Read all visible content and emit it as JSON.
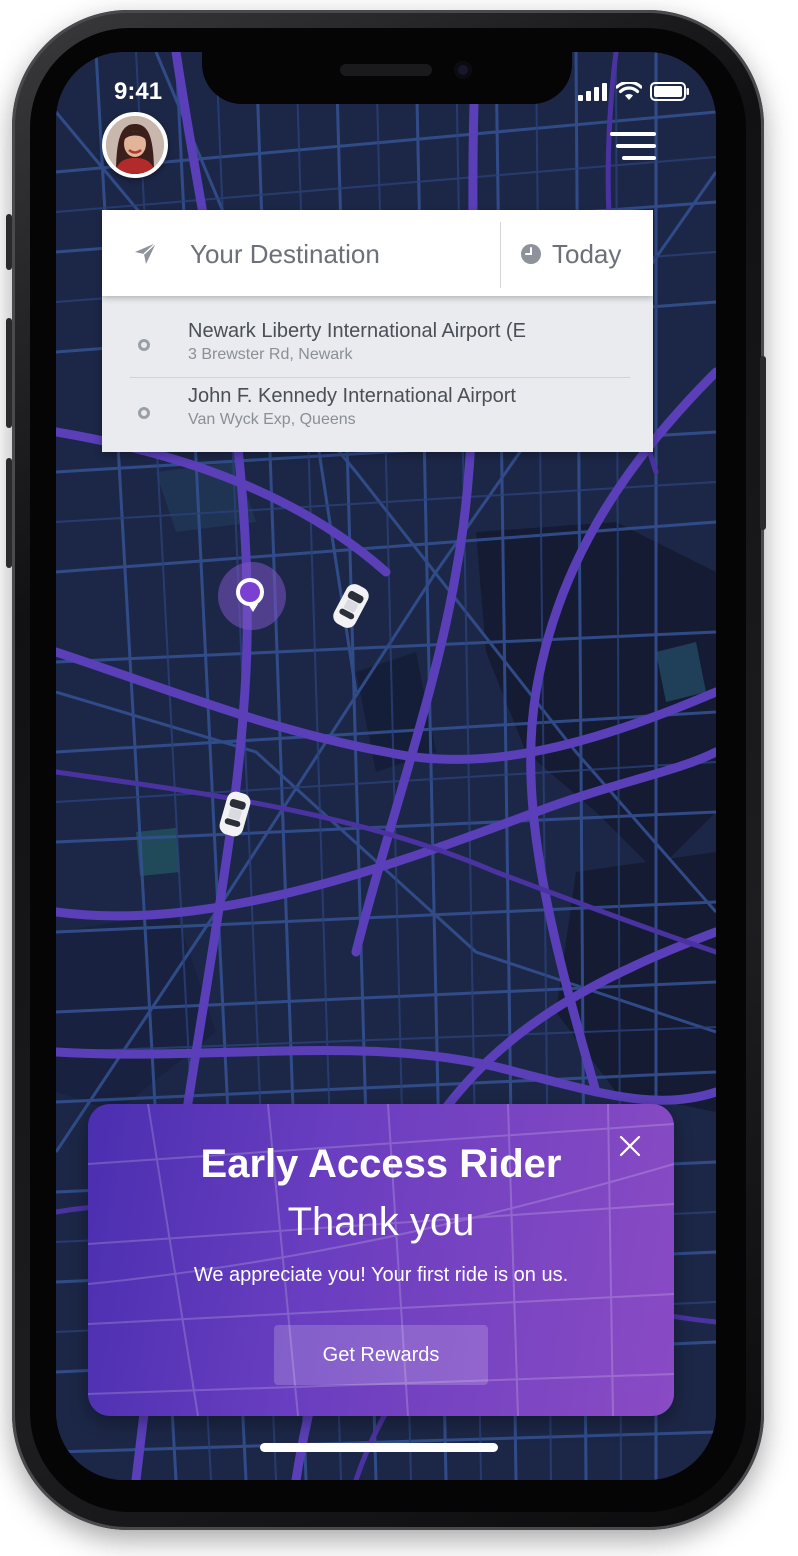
{
  "status_bar": {
    "time": "9:41",
    "icons": [
      "cellular-signal-icon",
      "wifi-icon",
      "battery-icon"
    ]
  },
  "header": {
    "avatar": "user-avatar",
    "menu_icon": "hamburger-menu-icon"
  },
  "search": {
    "placeholder": "Your Destination",
    "value": "",
    "when_label": "Today",
    "left_icon": "navigation-arrow-icon",
    "when_icon": "clock-icon"
  },
  "suggestions": [
    {
      "name": "Newark Liberty International Airport (E",
      "address": "3 Brewster Rd, Newark"
    },
    {
      "name": "John F. Kennedy International Airport",
      "address": "Van Wyck Exp, Queens"
    }
  ],
  "promo": {
    "title": "Early Access Rider",
    "subtitle": "Thank you",
    "message": "We appreciate you! Your first ride is on us.",
    "button_label": "Get Rewards"
  },
  "colors": {
    "map_background": "#1c2747",
    "map_roads": "#3a55a0",
    "map_highways": "#5a3fb8",
    "accent": "#7b3fd1",
    "promo_start": "#4a2fb0",
    "promo_end": "#8a4bc4"
  }
}
